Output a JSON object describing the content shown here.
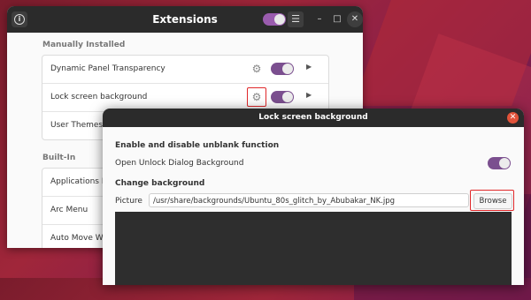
{
  "extensions_window": {
    "title": "Extensions",
    "manually_installed_label": "Manually Installed",
    "builtin_label": "Built-In",
    "manual_items": [
      {
        "label": "Dynamic Panel Transparency"
      },
      {
        "label": "Lock screen background"
      },
      {
        "label": "User Themes"
      }
    ],
    "builtin_items": [
      {
        "label": "Applications Menu"
      },
      {
        "label": "Arc Menu"
      },
      {
        "label": "Auto Move Windows"
      }
    ]
  },
  "dialog": {
    "title": "Lock screen background",
    "section_unblank": "Enable and disable unblank function",
    "open_unlock_label": "Open Unlock Dialog Background",
    "section_change": "Change background",
    "picture_label": "Picture",
    "picture_value": "/usr/share/backgrounds/Ubuntu_80s_glitch_by_Abubakar_NK.jpg",
    "browse_label": "Browse"
  },
  "colors": {
    "accent": "#7b4f8f",
    "highlight": "#e0282a",
    "header": "#2b2b2b"
  }
}
